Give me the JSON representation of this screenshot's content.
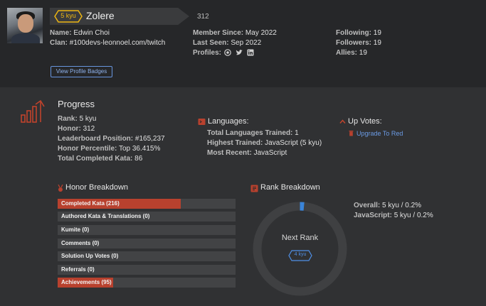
{
  "profile": {
    "rank_badge": "5 kyu",
    "username": "Zolere",
    "honor": "312",
    "name_label": "Name:",
    "name_value": "Edwin Choi",
    "clan_label": "Clan:",
    "clan_value": "#100devs-leonnoel.com/twitch",
    "member_since_label": "Member Since:",
    "member_since_value": "May 2022",
    "last_seen_label": "Last Seen:",
    "last_seen_value": "Sep 2022",
    "profiles_label": "Profiles:",
    "profile_icons": [
      "github-icon",
      "twitter-icon",
      "linkedin-icon"
    ],
    "following_label": "Following:",
    "following_value": "19",
    "followers_label": "Followers:",
    "followers_value": "19",
    "allies_label": "Allies:",
    "allies_value": "19",
    "view_badges_button": "View Profile Badges"
  },
  "progress": {
    "title": "Progress",
    "rank_label": "Rank:",
    "rank_value": "5 kyu",
    "honor_label": "Honor:",
    "honor_value": "312",
    "leaderboard_label": "Leaderboard Position:",
    "leaderboard_value": "#165,237",
    "percentile_label": "Honor Percentile:",
    "percentile_value": "Top 36.415%",
    "completed_label": "Total Completed Kata:",
    "completed_value": "86"
  },
  "languages": {
    "title": "Languages:",
    "trained_label": "Total Languages Trained:",
    "trained_value": "1",
    "highest_label": "Highest Trained:",
    "highest_value": "JavaScript (5 kyu)",
    "recent_label": "Most Recent:",
    "recent_value": "JavaScript"
  },
  "upvotes": {
    "title": "Up Votes:",
    "link": "Upgrade To Red"
  },
  "honor_breakdown": {
    "title": "Honor Breakdown",
    "bars": [
      {
        "label": "Completed Kata (216)",
        "fill": 0.69
      },
      {
        "label": "Authored Kata & Translations (0)",
        "fill": 0
      },
      {
        "label": "Kumite (0)",
        "fill": 0
      },
      {
        "label": "Comments (0)",
        "fill": 0
      },
      {
        "label": "Solution Up Votes (0)",
        "fill": 0
      },
      {
        "label": "Referrals (0)",
        "fill": 0
      },
      {
        "label": "Achievements (95)",
        "fill": 0.31
      }
    ]
  },
  "rank_breakdown": {
    "title": "Rank Breakdown",
    "next_rank_label": "Next Rank",
    "next_rank_badge": "4 kyu",
    "progress_fraction": 0.002,
    "overall_label": "Overall:",
    "overall_value": "5 kyu / 0.2%",
    "js_label": "JavaScript:",
    "js_value": "5 kyu / 0.2%"
  },
  "colors": {
    "accent_red": "#b8412e",
    "kyu_yellow": "#ecb613",
    "link_blue": "#6b9be5"
  }
}
